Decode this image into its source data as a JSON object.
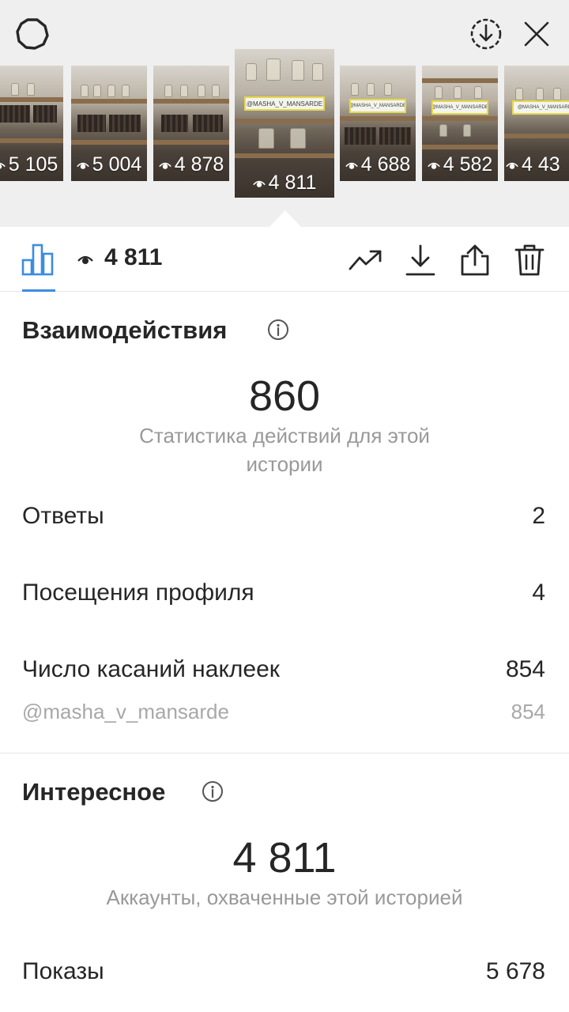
{
  "header": {
    "icons": [
      "settings-icon",
      "download-circle-icon",
      "close-icon"
    ]
  },
  "thumbnails": [
    {
      "views": "5 105",
      "active": false
    },
    {
      "views": "5 004",
      "active": false
    },
    {
      "views": "4 878",
      "active": false
    },
    {
      "views": "4 811",
      "active": true,
      "tag": "@MASHA_V_MANSARDE"
    },
    {
      "views": "4 688",
      "active": false,
      "tag": "@MASHA_V_MANSARDE"
    },
    {
      "views": "4 582",
      "active": false,
      "tag": "@MASHA_V_MANSARDE"
    },
    {
      "views": "4 43",
      "active": false,
      "tag": "@MASHA_V_MANSARDE"
    }
  ],
  "toolbar": {
    "views_count": "4 811",
    "icons": [
      "bar-chart-icon",
      "eye-icon",
      "trending-icon",
      "download-icon",
      "share-icon",
      "trash-icon"
    ],
    "accent_color": "#3c8de0"
  },
  "interactions": {
    "title": "Взаимодействия",
    "total": "860",
    "caption": "Статистика действий для этой истории",
    "rows": [
      {
        "label": "Ответы",
        "value": "2"
      },
      {
        "label": "Посещения профиля",
        "value": "4"
      },
      {
        "label": "Число касаний наклеек",
        "value": "854"
      }
    ],
    "sticker": {
      "label": "@masha_v_mansarde",
      "value": "854"
    }
  },
  "discovery": {
    "title": "Интересное",
    "total": "4 811",
    "caption": "Аккаунты, охваченные этой историей",
    "rows": [
      {
        "label": "Показы",
        "value": "5 678"
      }
    ]
  }
}
